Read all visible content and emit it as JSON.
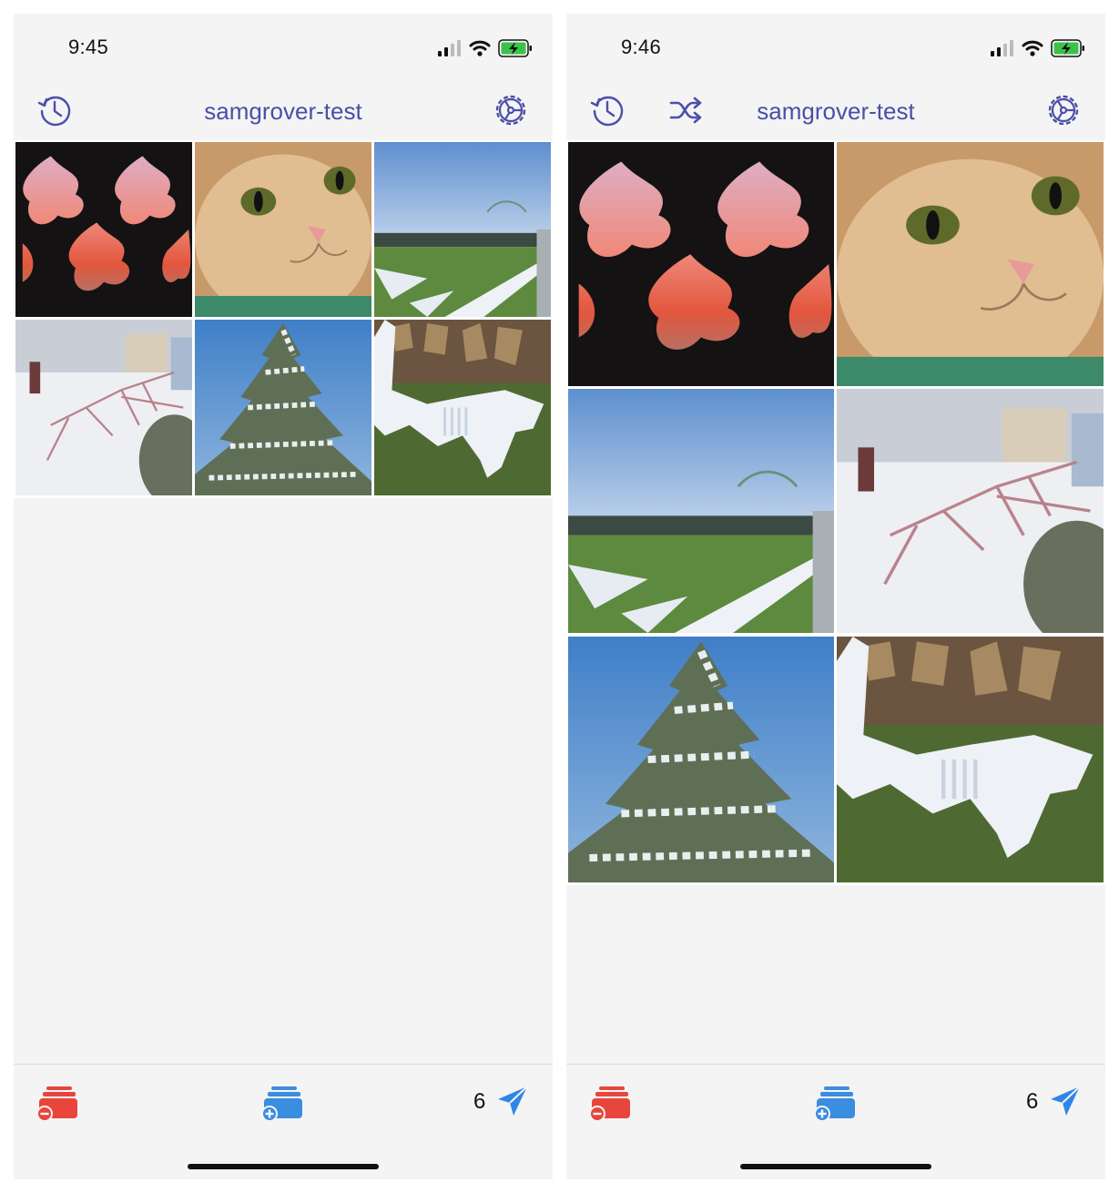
{
  "colors": {
    "accent": "#4a4fa8",
    "remove_red": "#e8453c",
    "add_blue": "#3b8de0",
    "send_blue": "#2f86e6",
    "background": "#f4f4f4"
  },
  "screens": [
    {
      "status": {
        "time": "9:45"
      },
      "nav": {
        "title": "samgrover-test",
        "left_icons": [
          "history-icon"
        ],
        "right_icon": "settings-icon"
      },
      "grid_columns": 3,
      "photos": [
        "sunset-lattice",
        "orange-cat",
        "snowy-field",
        "frozen-branch",
        "snowy-evergreen",
        "woodpile-snow"
      ],
      "toolbar": {
        "remove_icon": "remove-from-stack-icon",
        "add_icon": "add-to-stack-icon",
        "count": "6",
        "send_icon": "send-icon"
      }
    },
    {
      "status": {
        "time": "9:46"
      },
      "nav": {
        "title": "samgrover-test",
        "left_icons": [
          "history-icon",
          "shuffle-icon"
        ],
        "right_icon": "settings-icon"
      },
      "grid_columns": 2,
      "photos": [
        "sunset-lattice",
        "orange-cat",
        "snowy-field",
        "frozen-branch",
        "snowy-evergreen",
        "woodpile-snow"
      ],
      "toolbar": {
        "remove_icon": "remove-from-stack-icon",
        "add_icon": "add-to-stack-icon",
        "count": "6",
        "send_icon": "send-icon"
      }
    }
  ]
}
